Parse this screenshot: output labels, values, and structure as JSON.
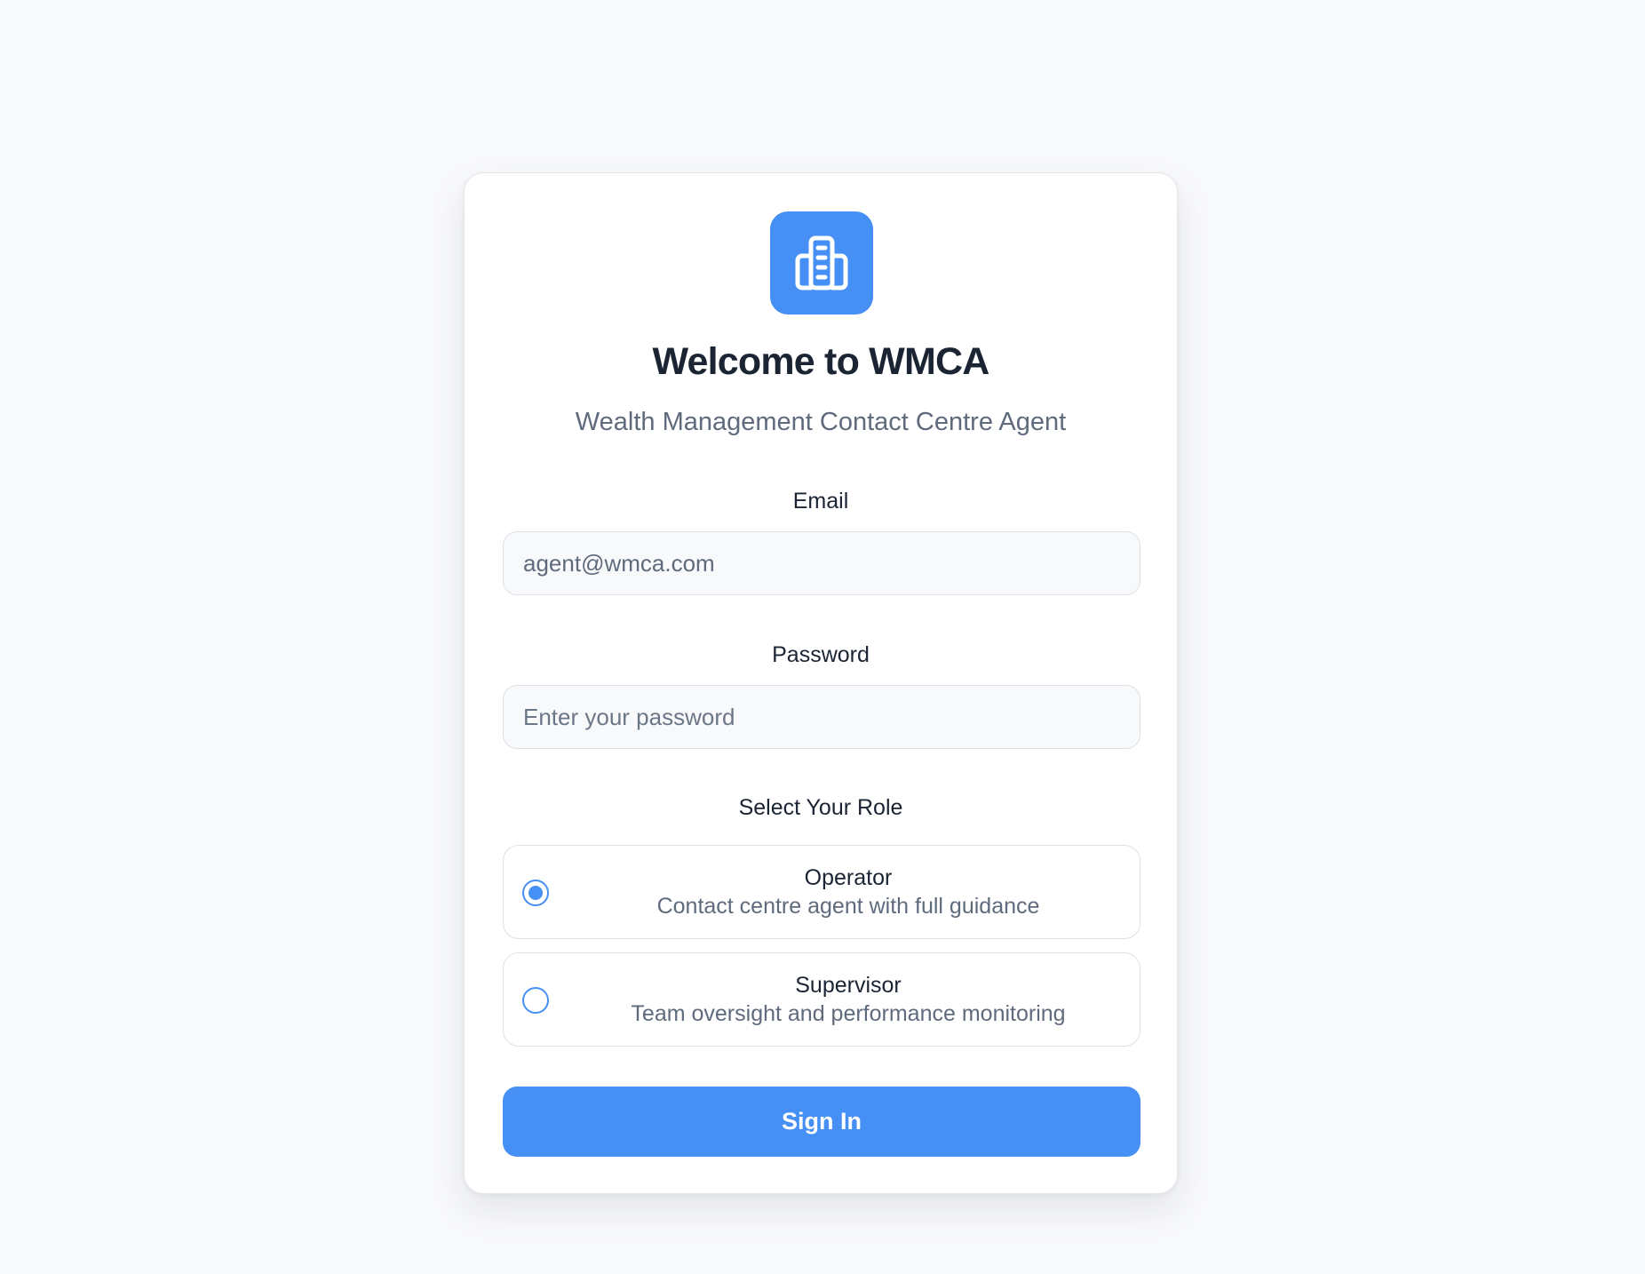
{
  "header": {
    "logo_icon": "building-icon",
    "title": "Welcome to WMCA",
    "subtitle": "Wealth Management Contact Centre Agent"
  },
  "form": {
    "email": {
      "label": "Email",
      "value": "agent@wmca.com",
      "placeholder": ""
    },
    "password": {
      "label": "Password",
      "value": "",
      "placeholder": "Enter your password"
    },
    "role": {
      "label": "Select Your Role",
      "selected": "Operator",
      "options": [
        {
          "name": "Operator",
          "description": "Contact centre agent with full guidance",
          "checked": true
        },
        {
          "name": "Supervisor",
          "description": "Team oversight and performance monitoring",
          "checked": false
        }
      ]
    },
    "submit_label": "Sign In"
  },
  "colors": {
    "accent": "#4690f5",
    "background": "#f8f9fb",
    "title_text": "#1b2433",
    "muted_text": "#5f6b7d"
  }
}
